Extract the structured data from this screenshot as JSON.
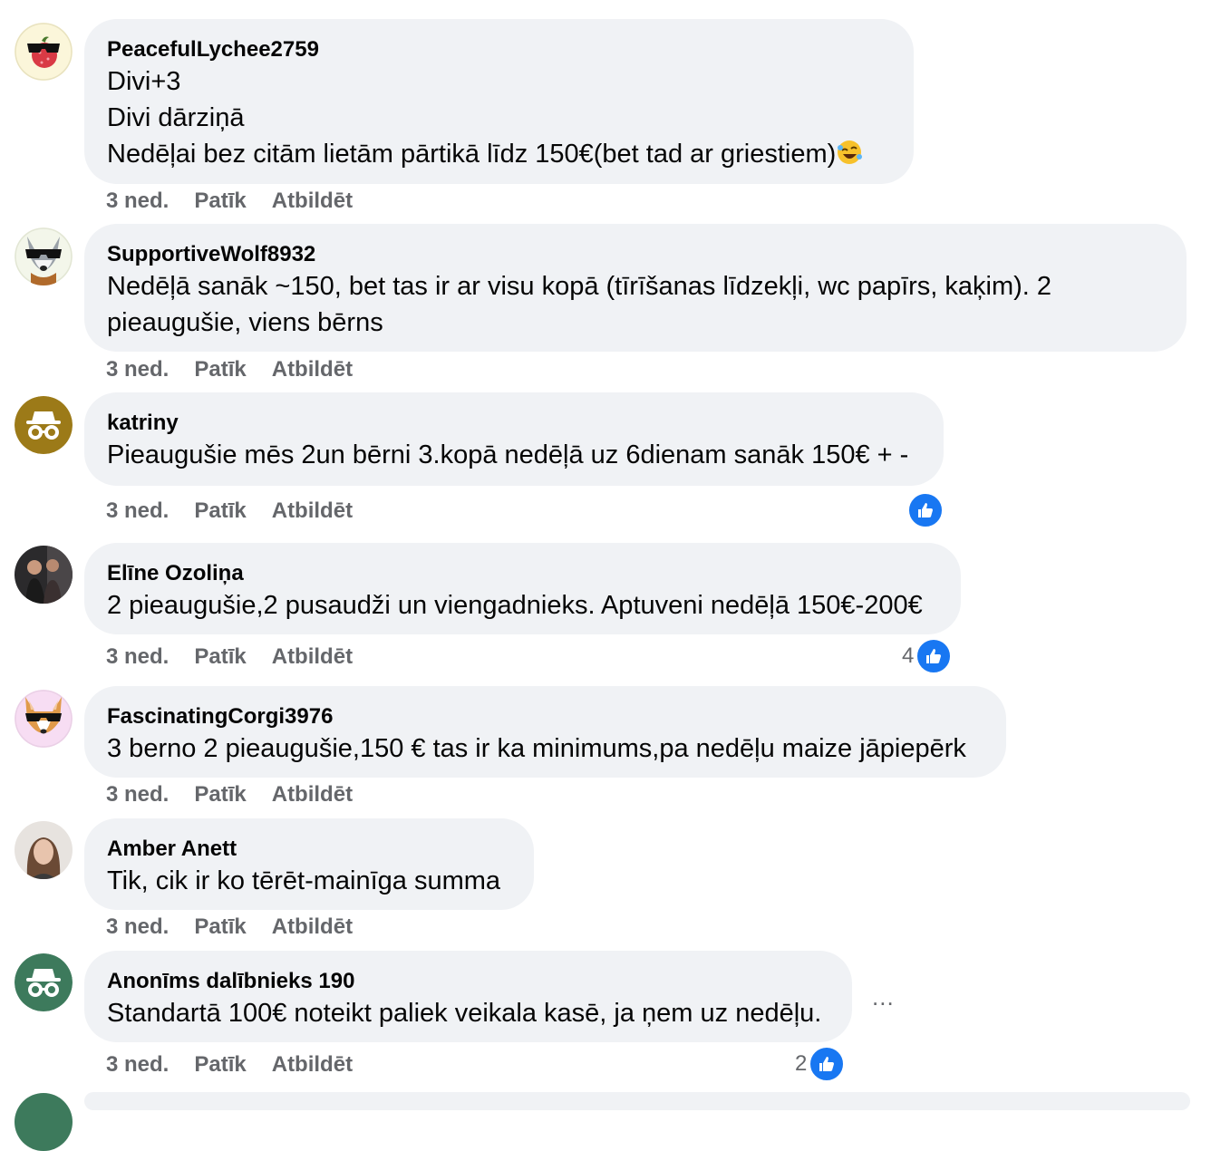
{
  "comments": [
    {
      "author": "PeacefulLychee2759",
      "lines": [
        "Divi+3",
        "Divi dārziņā",
        "Nedēļai bez citām lietām pārtikā līdz 150€(bet tad ar griestiem)"
      ],
      "emoji": "rolling-on-floor-laughing",
      "time": "3 ned.",
      "like_label": "Patīk",
      "reply_label": "Atbildēt",
      "avatar": "lychee-sunglasses-avatar"
    },
    {
      "author": "SupportiveWolf8932",
      "text": "Nedēļā sanāk ~150, bet tas ir ar visu kopā (tīrīšanas līdzekļi, wc papīrs, kaķim). 2 pieaugušie, viens bērns",
      "time": "3 ned.",
      "like_label": "Patīk",
      "reply_label": "Atbildēt",
      "avatar": "wolf-sunglasses-avatar"
    },
    {
      "author": "katriny",
      "text": "Pieaugušie mēs 2un bērni 3.kopā nedēļā uz 6dienam sanāk 150€ + -",
      "time": "3 ned.",
      "like_label": "Patīk",
      "reply_label": "Atbildēt",
      "reaction_count": "",
      "avatar": "anonymous-gold-avatar"
    },
    {
      "author": "Elīne Ozoliņa",
      "text": "2 pieaugušie,2 pusaudži un viengadnieks. Aptuveni nedēļā 150€-200€",
      "time": "3 ned.",
      "like_label": "Patīk",
      "reply_label": "Atbildēt",
      "reaction_count": "4",
      "avatar": "photo-avatar"
    },
    {
      "author": "FascinatingCorgi3976",
      "text": "3 berno 2 pieaugušie,150 € tas ir ka minimums,pa nedēļu maize jāpiepērk",
      "time": "3 ned.",
      "like_label": "Patīk",
      "reply_label": "Atbildēt",
      "avatar": "corgi-sunglasses-avatar"
    },
    {
      "author": "Amber Anett",
      "text": "Tik, cik ir ko tērēt-mainīga summa",
      "time": "3 ned.",
      "like_label": "Patīk",
      "reply_label": "Atbildēt",
      "avatar": "photo-avatar"
    },
    {
      "author": "Anonīms dalībnieks 190",
      "text": "Standartā 100€ noteikt paliek veikala kasē, ja ņem uz nedēļu.",
      "time": "3 ned.",
      "like_label": "Patīk",
      "reply_label": "Atbildēt",
      "reaction_count": "2",
      "avatar": "anonymous-green-avatar"
    }
  ],
  "more_options": "...",
  "colors": {
    "bubble": "#f0f2f5",
    "meta": "#65676b",
    "like_blue": "#1877f2"
  }
}
